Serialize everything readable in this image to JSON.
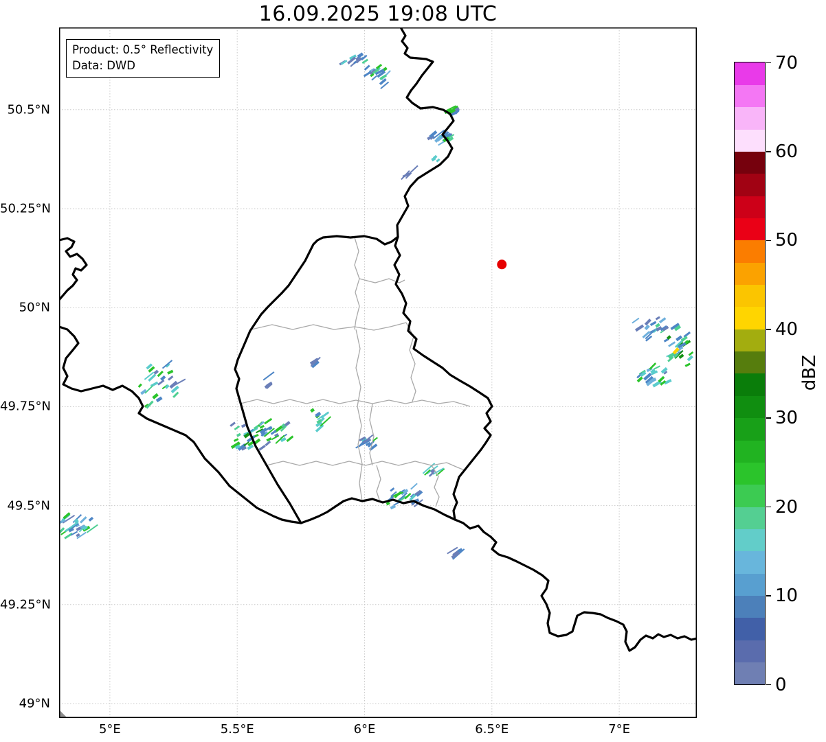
{
  "title": "16.09.2025 19:08 UTC",
  "info_box": {
    "line1": "Product: 0.5° Reflectivity",
    "line2": "Data: DWD"
  },
  "map": {
    "extent": {
      "lon_min": 4.8006,
      "lon_max": 7.3046,
      "lat_min": 48.9636,
      "lat_max": 50.7076
    },
    "grid_color": "#c9c9c9",
    "frame_color": "#000000",
    "x_ticks": [
      {
        "value": 5.0,
        "label": "5°E"
      },
      {
        "value": 5.5,
        "label": "5.5°E"
      },
      {
        "value": 6.0,
        "label": "6°E"
      },
      {
        "value": 6.5,
        "label": "6.5°E"
      },
      {
        "value": 7.0,
        "label": "7°E"
      }
    ],
    "y_ticks": [
      {
        "value": 50.5,
        "label": "50.5°N"
      },
      {
        "value": 50.25,
        "label": "50.25°N"
      },
      {
        "value": 50.0,
        "label": "50°N"
      },
      {
        "value": 49.75,
        "label": "49.75°N"
      },
      {
        "value": 49.5,
        "label": "49.5°N"
      },
      {
        "value": 49.25,
        "label": "49.25°N"
      },
      {
        "value": 49.0,
        "label": "49°N"
      }
    ],
    "radar_site": {
      "lon": 6.539,
      "lat": 50.109,
      "color": "#e60000",
      "radius": 7
    }
  },
  "colorbar": {
    "label": "dBZ",
    "min": 0,
    "max": 70,
    "band_step": 2.5,
    "ticks": [
      {
        "value": 0,
        "label": "0"
      },
      {
        "value": 10,
        "label": "10"
      },
      {
        "value": 20,
        "label": "20"
      },
      {
        "value": 30,
        "label": "30"
      },
      {
        "value": 40,
        "label": "40"
      },
      {
        "value": 50,
        "label": "50"
      },
      {
        "value": 60,
        "label": "60"
      },
      {
        "value": 70,
        "label": "70"
      }
    ],
    "colors": [
      "#6f7fb3",
      "#5a6cad",
      "#4160a8",
      "#4c80ba",
      "#589fd0",
      "#68b6dc",
      "#62cdc9",
      "#54cf92",
      "#3ccb52",
      "#2bc42b",
      "#21b321",
      "#18a018",
      "#108e10",
      "#0a7d0a",
      "#567d0d",
      "#a3ad0f",
      "#ffd500",
      "#fbc500",
      "#fba200",
      "#fb7d00",
      "#ea0016",
      "#cd0018",
      "#a10213",
      "#76010d",
      "#fddffd",
      "#f9b5f9",
      "#f477f4",
      "#e93ae9"
    ]
  },
  "echo_palette": {
    "slate": "#6b7fb8",
    "blue": "#4e86c6",
    "sky": "#6fb0dc",
    "cyan": "#5bcccc",
    "teal": "#4ecf92",
    "green": "#2bc42b",
    "dgreen": "#149114",
    "yellow": "#ffd500"
  },
  "echo_clusters": [
    {
      "lon": 5.968,
      "lat": 50.626,
      "slon": 0.038,
      "slat": 0.014,
      "n": 12,
      "seed": 11,
      "colors": {
        "slate": 3,
        "blue": 3,
        "sky": 1,
        "cyan": 2,
        "teal": 1
      }
    },
    {
      "lon": 6.059,
      "lat": 50.583,
      "slon": 0.035,
      "slat": 0.021,
      "n": 16,
      "seed": 22,
      "colors": {
        "slate": 3,
        "blue": 4,
        "sky": 1,
        "cyan": 1,
        "teal": 1,
        "green": 2
      }
    },
    {
      "lon": 6.348,
      "lat": 50.498,
      "slon": 0.019,
      "slat": 0.009,
      "n": 7,
      "seed": 33,
      "colors": {
        "slate": 2,
        "blue": 3,
        "green": 2
      }
    },
    {
      "lon": 6.307,
      "lat": 50.431,
      "slon": 0.043,
      "slat": 0.017,
      "n": 18,
      "seed": 44,
      "colors": {
        "slate": 3,
        "blue": 4,
        "sky": 2,
        "cyan": 1,
        "teal": 1,
        "green": 2
      }
    },
    {
      "lon": 6.283,
      "lat": 50.377,
      "slon": 0.011,
      "slat": 0.007,
      "n": 3,
      "seed": 55,
      "colors": {
        "cyan": 3,
        "blue": 1
      }
    },
    {
      "lon": 6.178,
      "lat": 50.334,
      "slon": 0.013,
      "slat": 0.012,
      "n": 4,
      "seed": 66,
      "colors": {
        "slate": 3,
        "blue": 2
      }
    },
    {
      "lon": 5.806,
      "lat": 49.865,
      "slon": 0.013,
      "slat": 0.014,
      "n": 6,
      "seed": 77,
      "colors": {
        "slate": 3,
        "blue": 2,
        "sky": 1
      }
    },
    {
      "lon": 5.189,
      "lat": 49.808,
      "slon": 0.059,
      "slat": 0.038,
      "n": 26,
      "seed": 88,
      "colors": {
        "slate": 4,
        "blue": 4,
        "sky": 2,
        "cyan": 3,
        "teal": 2,
        "green": 3
      }
    },
    {
      "lon": 5.623,
      "lat": 49.811,
      "slon": 0.011,
      "slat": 0.017,
      "n": 5,
      "seed": 99,
      "colors": {
        "slate": 3,
        "blue": 2
      }
    },
    {
      "lon": 5.588,
      "lat": 49.68,
      "slon": 0.081,
      "slat": 0.035,
      "n": 46,
      "seed": 111,
      "colors": {
        "slate": 4,
        "blue": 5,
        "sky": 3,
        "cyan": 3,
        "teal": 2,
        "green": 4,
        "dgreen": 1
      }
    },
    {
      "lon": 5.825,
      "lat": 49.725,
      "slon": 0.024,
      "slat": 0.024,
      "n": 10,
      "seed": 122,
      "colors": {
        "blue": 2,
        "cyan": 2,
        "teal": 2,
        "green": 3
      }
    },
    {
      "lon": 6.013,
      "lat": 49.661,
      "slon": 0.027,
      "slat": 0.014,
      "n": 10,
      "seed": 133,
      "colors": {
        "slate": 3,
        "blue": 3,
        "cyan": 1,
        "green": 2
      }
    },
    {
      "lon": 6.267,
      "lat": 49.588,
      "slon": 0.022,
      "slat": 0.009,
      "n": 7,
      "seed": 144,
      "colors": {
        "slate": 2,
        "blue": 2,
        "cyan": 2,
        "green": 1
      }
    },
    {
      "lon": 6.164,
      "lat": 49.528,
      "slon": 0.054,
      "slat": 0.021,
      "n": 22,
      "seed": 155,
      "colors": {
        "slate": 4,
        "blue": 4,
        "sky": 2,
        "cyan": 3,
        "teal": 1,
        "green": 3
      }
    },
    {
      "lon": 4.857,
      "lat": 49.445,
      "slon": 0.054,
      "slat": 0.031,
      "n": 26,
      "seed": 166,
      "colors": {
        "slate": 2,
        "blue": 4,
        "sky": 3,
        "cyan": 4,
        "teal": 2,
        "green": 3
      }
    },
    {
      "lon": 6.367,
      "lat": 49.384,
      "slon": 0.016,
      "slat": 0.007,
      "n": 5,
      "seed": 177,
      "colors": {
        "slate": 4,
        "blue": 2
      }
    },
    {
      "lon": 7.129,
      "lat": 49.946,
      "slon": 0.049,
      "slat": 0.021,
      "n": 18,
      "seed": 188,
      "colors": {
        "slate": 3,
        "blue": 4,
        "sky": 2,
        "cyan": 2,
        "teal": 1
      }
    },
    {
      "lon": 7.237,
      "lat": 49.903,
      "slon": 0.038,
      "slat": 0.038,
      "n": 26,
      "seed": 199,
      "colors": {
        "blue": 2,
        "sky": 2,
        "cyan": 3,
        "teal": 3,
        "green": 4,
        "dgreen": 2
      }
    },
    {
      "lon": 7.129,
      "lat": 49.825,
      "slon": 0.054,
      "slat": 0.021,
      "n": 20,
      "seed": 211,
      "colors": {
        "slate": 2,
        "blue": 3,
        "sky": 2,
        "cyan": 4,
        "teal": 2,
        "green": 2
      }
    },
    {
      "lon": 7.224,
      "lat": 49.891,
      "slon": 0.004,
      "slat": 0.004,
      "n": 1,
      "seed": 222,
      "colors": {
        "yellow": 1
      }
    }
  ]
}
